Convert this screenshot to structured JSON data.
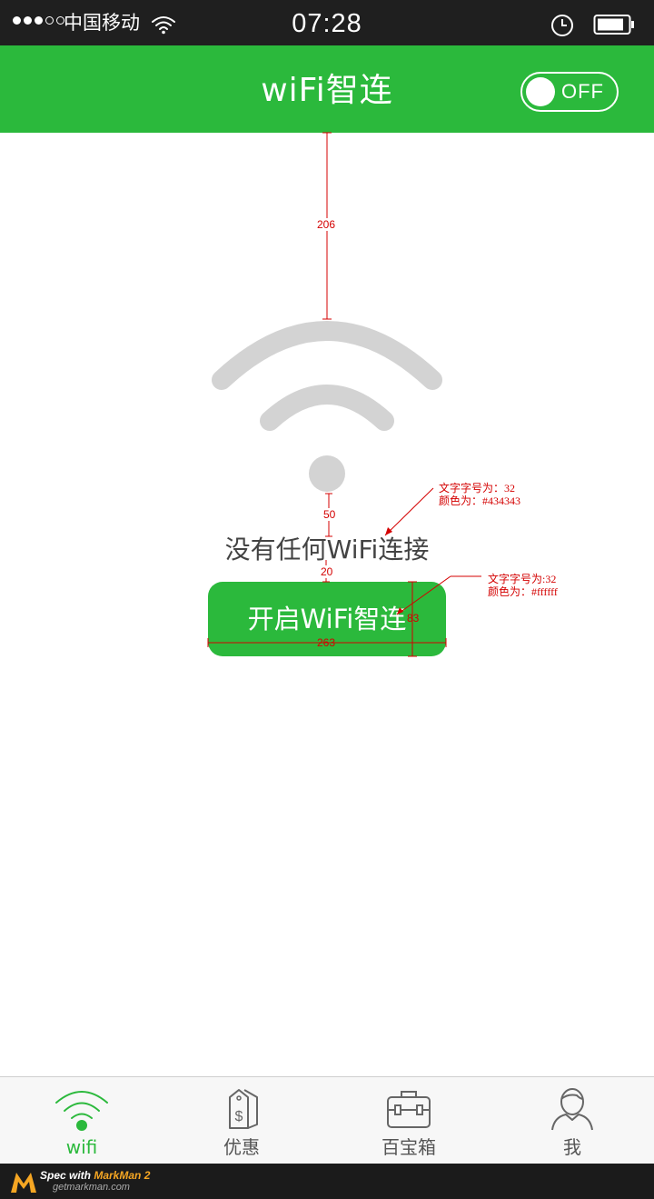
{
  "status_bar": {
    "carrier": "中国移动",
    "time": "07:28"
  },
  "header": {
    "title": "wiFi智连",
    "toggle_label": "OFF",
    "toggle_state": "off"
  },
  "main": {
    "empty_message": "没有任何WiFi连接",
    "connect_button_label": "开启WiFi智连"
  },
  "spec_annotations": {
    "gap_top": "206",
    "gap_icon_text": "50",
    "gap_text_button": "20",
    "button_width": "263",
    "button_height": "83",
    "note_text_size": "文字字号为：32",
    "note_text_color": "颜色为：#434343",
    "note_button_size": "文字字号为:32",
    "note_button_color": "颜色为：#ffffff"
  },
  "tabbar": {
    "items": [
      {
        "label": "wifi",
        "icon": "wifi-icon",
        "active": true
      },
      {
        "label": "优惠",
        "icon": "price-tag-icon",
        "active": false
      },
      {
        "label": "百宝箱",
        "icon": "toolbox-icon",
        "active": false
      },
      {
        "label": "我",
        "icon": "user-icon",
        "active": false
      }
    ]
  },
  "footer": {
    "line1_prefix": "Spec with ",
    "line1_brand": "MarkMan 2",
    "line2": "getmarkman.com"
  },
  "colors": {
    "accent": "#2bb93c",
    "text": "#434343",
    "status_bar": "#1f1f1f",
    "annotation": "#d40000",
    "wifi_graphic": "#d3d3d3"
  }
}
